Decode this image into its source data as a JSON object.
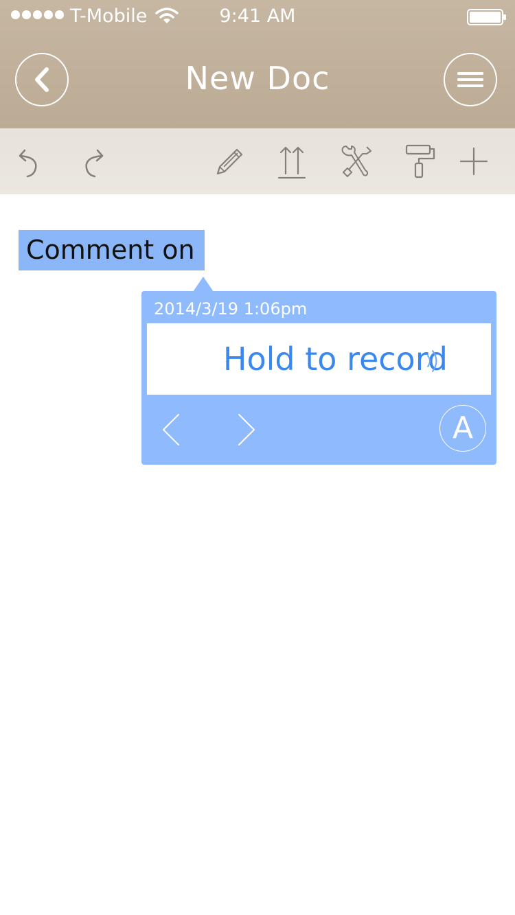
{
  "status_bar": {
    "signal_icon": "signal-dots-icon",
    "carrier": "T-Mobile",
    "wifi_icon": "wifi-icon",
    "time": "9:41 AM",
    "battery_icon": "battery-icon"
  },
  "nav": {
    "back_icon": "chevron-left-icon",
    "title": "New Doc",
    "menu_icon": "hamburger-menu-icon"
  },
  "toolbar": {
    "items": [
      {
        "name": "undo",
        "icon": "undo-icon"
      },
      {
        "name": "redo",
        "icon": "redo-icon"
      },
      {
        "name": "edit",
        "icon": "pencil-icon"
      },
      {
        "name": "export",
        "icon": "upload-arrows-icon"
      },
      {
        "name": "tools",
        "icon": "wrench-screwdriver-icon"
      },
      {
        "name": "style",
        "icon": "paint-roller-icon"
      },
      {
        "name": "add",
        "icon": "plus-icon"
      }
    ]
  },
  "document": {
    "selected_text": "Comment on"
  },
  "comment": {
    "date": "2014/3/19 1:06pm",
    "record_label": "Hold to record",
    "prev_icon": "chevron-left-icon",
    "next_icon": "chevron-right-icon",
    "author_initial": "A"
  },
  "colors": {
    "header_bg": "#c2b29d",
    "toolbar_bg": "#e9e5de",
    "highlight": "#8bb6f8",
    "comment_bg": "#8fbafc",
    "record_text": "#3a88ee"
  }
}
